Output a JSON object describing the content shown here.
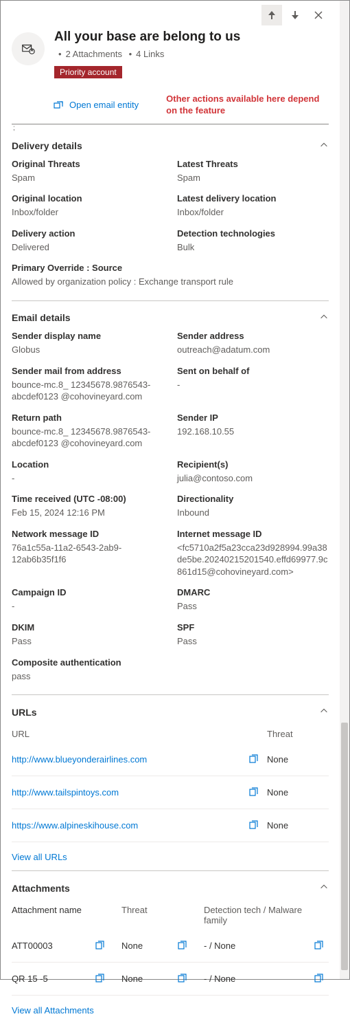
{
  "header": {
    "title": "All your base are belong to us",
    "attachments_label": "2 Attachments",
    "links_label": "4 Links",
    "badge": "Priority account",
    "open_entity": "Open email entity",
    "hint": "Other actions available here depend on the feature"
  },
  "delivery": {
    "section_title": "Delivery details",
    "original_threats": {
      "label": "Original Threats",
      "value": "Spam"
    },
    "latest_threats": {
      "label": "Latest Threats",
      "value": "Spam"
    },
    "original_location": {
      "label": "Original location",
      "value": "Inbox/folder"
    },
    "latest_location": {
      "label": "Latest delivery location",
      "value": "Inbox/folder"
    },
    "delivery_action": {
      "label": "Delivery action",
      "value": "Delivered"
    },
    "detection_tech": {
      "label": "Detection technologies",
      "value": "Bulk"
    },
    "primary_override": {
      "label": "Primary Override : Source",
      "value": "Allowed by organization policy : Exchange transport rule"
    }
  },
  "email": {
    "section_title": "Email details",
    "sender_display": {
      "label": "Sender display name",
      "value": "Globus"
    },
    "sender_address": {
      "label": "Sender address",
      "value": "outreach@adatum.com"
    },
    "mail_from": {
      "label": "Sender mail from address",
      "value": "bounce-mc.8_ 12345678.9876543-abcdef0123 @cohovineyard.com"
    },
    "behalf": {
      "label": "Sent on behalf of",
      "value": "-"
    },
    "return_path": {
      "label": "Return path",
      "value": "bounce-mc.8_ 12345678.9876543-abcdef0123 @cohovineyard.com"
    },
    "sender_ip": {
      "label": "Sender IP",
      "value": "192.168.10.55"
    },
    "location": {
      "label": "Location",
      "value": "-"
    },
    "recipients": {
      "label": "Recipient(s)",
      "value": "julia@contoso.com"
    },
    "time_received": {
      "label": "Time received (UTC -08:00)",
      "value": "Feb 15, 2024 12:16 PM"
    },
    "directionality": {
      "label": "Directionality",
      "value": "Inbound"
    },
    "network_id": {
      "label": "Network message ID",
      "value": "76a1c55a-11a2-6543-2ab9-12ab6b35f1f6"
    },
    "internet_id": {
      "label": "Internet message ID",
      "value": "<fc5710a2f5a23cca23d928994.99a38de5be.20240215201540.effd69977.9c861d15@cohovineyard.com>"
    },
    "campaign": {
      "label": "Campaign ID",
      "value": "-"
    },
    "dmarc": {
      "label": "DMARC",
      "value": "Pass"
    },
    "dkim": {
      "label": "DKIM",
      "value": "Pass"
    },
    "spf": {
      "label": "SPF",
      "value": "Pass"
    },
    "composite": {
      "label": "Composite authentication",
      "value": "pass"
    }
  },
  "urls": {
    "section_title": "URLs",
    "col_url": "URL",
    "col_threat": "Threat",
    "rows": [
      {
        "url": "http://www.blueyonderairlines.com",
        "threat": "None"
      },
      {
        "url": "http://www.tailspintoys.com",
        "threat": "None"
      },
      {
        "url": "https://www.alpineskihouse.com",
        "threat": "None"
      }
    ],
    "view_all": "View all URLs"
  },
  "attachments": {
    "section_title": "Attachments",
    "col_name": "Attachment name",
    "col_threat": "Threat",
    "col_detect": "Detection tech / Malware family",
    "rows": [
      {
        "name": "ATT00003",
        "threat": "None",
        "detect": "- / None"
      },
      {
        "name": "QR 15 -5",
        "threat": "None",
        "detect": "- / None"
      }
    ],
    "view_all": "View all Attachments"
  }
}
